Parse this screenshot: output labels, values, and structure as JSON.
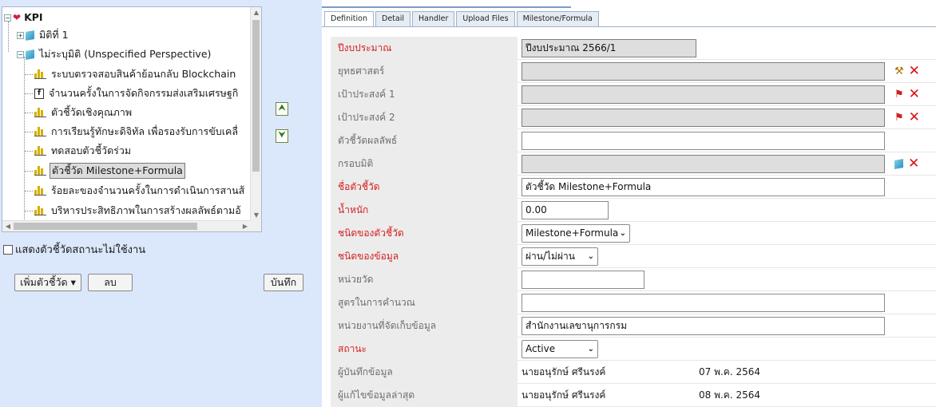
{
  "tree": {
    "root": "KPI",
    "nodes": [
      {
        "label": "มิติที่ 1"
      },
      {
        "label": "ไม่ระบุมิติ (Unspecified Perspective)"
      },
      {
        "label": "ระบบตรวจสอบสินค้าย้อนกลับ Blockchain"
      },
      {
        "label": "จำนวนครั้งในการจัดกิจกรรมส่งเสริมเศรษฐกิ"
      },
      {
        "label": "ตัวชี้วัดเชิงคุณภาพ"
      },
      {
        "label": "การเรียนรู้ทักษะดิจิทัล เพื่อรองรับการขับเคลื่"
      },
      {
        "label": "ทดสอบตัวชี้วัดร่วม"
      },
      {
        "label": "ตัวชี้วัด Milestone+Formula"
      },
      {
        "label": "ร้อยละของจำนวนครั้งในการดำเนินการสานส้"
      },
      {
        "label": "บริหารประสิทธิภาพในการสร้างผลลัพธ์ตามอ้"
      }
    ]
  },
  "left": {
    "move_up": "⮝",
    "move_down": "⮟",
    "show_inactive_label": "แสดงตัวชี้วัดสถานะไม่ใช้งาน",
    "add_kpi": "เพิ่มตัวชี้วัด ▾",
    "delete": "ลบ",
    "save": "บันทึก"
  },
  "tabs": [
    "Definition",
    "Detail",
    "Handler",
    "Upload Files",
    "Milestone/Formula"
  ],
  "form": {
    "budget_year": {
      "label": "ปีงบประมาณ",
      "value": "ปีงบประมาณ 2566/1"
    },
    "strategy": {
      "label": "ยุทธศาสตร์",
      "value": ""
    },
    "objective1": {
      "label": "เป้าประสงค์ 1",
      "value": ""
    },
    "objective2": {
      "label": "เป้าประสงค์ 2",
      "value": ""
    },
    "outcome_kpi": {
      "label": "ตัวชี้วัดผลลัพธ์",
      "value": ""
    },
    "perspective": {
      "label": "กรอบมิติ",
      "value": ""
    },
    "kpi_name": {
      "label": "ชื่อตัวชี้วัด",
      "value": "ตัวชี้วัด Milestone+Formula"
    },
    "weight": {
      "label": "น้ำหนัก",
      "value": "0.00"
    },
    "kpi_type": {
      "label": "ชนิดของตัวชี้วัด",
      "value": "Milestone+Formula"
    },
    "data_type": {
      "label": "ชนิดของข้อมูล",
      "value": "ผ่าน/ไม่ผ่าน"
    },
    "unit": {
      "label": "หน่วยวัด",
      "value": ""
    },
    "formula": {
      "label": "สูตรในการคำนวณ",
      "value": ""
    },
    "data_unit": {
      "label": "หน่วยงานที่จัดเก็บข้อมูล",
      "value": "สำนักงานเลขานุการกรม"
    },
    "status": {
      "label": "สถานะ",
      "value": "Active"
    },
    "recorder": {
      "label": "ผู้บันทึกข้อมูล",
      "name": "นายอนุรักษ์ ศรีนรงค์",
      "date": "07 พ.ค. 2564"
    },
    "last_editor": {
      "label": "ผู้แก้ไขข้อมูลล่าสุด",
      "name": "นายอนุรักษ์ ศรีนรงค์",
      "date": "08 พ.ค. 2564"
    }
  },
  "colors": {
    "required_label": "#d42020",
    "panel_bg": "#dbe8fb",
    "delete_icon": "#dd1111"
  }
}
